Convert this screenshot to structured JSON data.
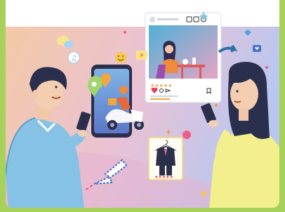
{
  "illustration": {
    "post_card": {
      "stars": "★★★★★",
      "like_icon": "heart-icon",
      "comment_icon": "comment-bubble-icon",
      "share_icon": "send-icon",
      "save_icon": "bookmark-icon"
    },
    "clothing_card": {
      "stars": "★★★★★"
    },
    "colors": {
      "page_border": "#a6d15a",
      "background_top": "#ffffff",
      "background_gradient_start": "#f4c9a6",
      "background_gradient_end": "#b9c7ef",
      "left_person_shirt": "#86c2e6",
      "right_person_shirt": "#f3ef8c",
      "accent_pink": "#ef5b86",
      "accent_orange": "#f29a3a"
    }
  }
}
